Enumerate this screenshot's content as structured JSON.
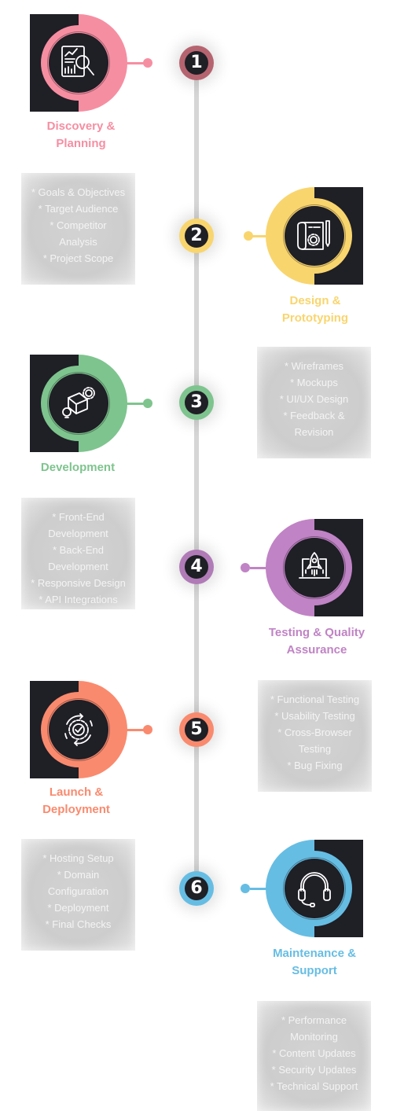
{
  "steps": [
    {
      "number": "1",
      "title_lines": [
        "Discovery &",
        "Planning"
      ],
      "color": "#f68ea2",
      "badge_color": "#b5646f",
      "icon": "report-magnifier-icon",
      "side": "left",
      "items": [
        "* Goals & Objectives",
        "* Target Audience",
        "* Competitor",
        "Analysis",
        "* Project Scope"
      ]
    },
    {
      "number": "2",
      "title_lines": [
        "Design &",
        "Prototyping"
      ],
      "color": "#f9d56e",
      "badge_color": "#f9d56e",
      "icon": "blueprint-gear-icon",
      "side": "right",
      "items": [
        "* Wireframes",
        "* Mockups",
        "* UI/UX Design",
        "* Feedback &",
        "Revision"
      ]
    },
    {
      "number": "3",
      "title_lines": [
        "Development"
      ],
      "color": "#7ec48e",
      "badge_color": "#7ec48e",
      "icon": "package-gear-bulb-icon",
      "side": "left",
      "items": [
        "* Front-End",
        "Development",
        "* Back-End",
        "Development",
        "* Responsive Design",
        "* API Integrations"
      ]
    },
    {
      "number": "4",
      "title_lines": [
        "Testing & Quality",
        "Assurance"
      ],
      "color": "#c083c5",
      "badge_color": "#b07bb7",
      "icon": "rocket-laptop-icon",
      "side": "right",
      "items": [
        "* Functional Testing",
        "* Usability Testing",
        "* Cross-Browser",
        "Testing",
        "* Bug Fixing"
      ]
    },
    {
      "number": "5",
      "title_lines": [
        "Launch &",
        "Deployment"
      ],
      "color": "#fa8a6e",
      "badge_color": "#fa8a6e",
      "icon": "gear-check-cycle-icon",
      "side": "left",
      "items": [
        "* Hosting Setup",
        "* Domain",
        "Configuration",
        "* Deployment",
        "* Final Checks"
      ]
    },
    {
      "number": "6",
      "title_lines": [
        "Maintenance &",
        "Support"
      ],
      "color": "#66bde3",
      "badge_color": "#66bde3",
      "icon": "headset-icon",
      "side": "right",
      "items": [
        "* Performance",
        "Monitoring",
        "* Content Updates",
        "* Security Updates",
        "* Technical Support"
      ]
    }
  ]
}
